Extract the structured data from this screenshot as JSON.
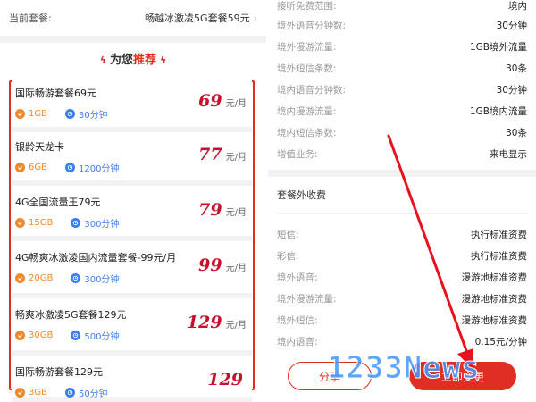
{
  "current_plan": {
    "label": "当前套餐:",
    "value": "畅越冰激凌5G套餐59元"
  },
  "recommend": {
    "title_prefix": "为您",
    "title_highlight": "推荐"
  },
  "cards": [
    {
      "name": "国际畅游套餐69元",
      "data": "1GB",
      "minutes": "30分钟",
      "price": "69",
      "unit": "元/月"
    },
    {
      "name": "银龄天龙卡",
      "data": "6GB",
      "minutes": "1200分钟",
      "price": "77",
      "unit": "元/月"
    },
    {
      "name": "4G全国流量王79元",
      "data": "15GB",
      "minutes": "300分钟",
      "price": "79",
      "unit": "元/月"
    },
    {
      "name": "4G畅爽冰激凌国内流量套餐-99元/月",
      "data": "20GB",
      "minutes": "300分钟",
      "price": "99",
      "unit": "元/月"
    },
    {
      "name": "畅爽冰激凌5G套餐129元",
      "data": "30GB",
      "minutes": "500分钟",
      "price": "129",
      "unit": "元/月"
    },
    {
      "name": "国际畅游套餐129元",
      "data": "3GB",
      "minutes": "50分钟",
      "price": "129",
      "unit": ""
    }
  ],
  "details": [
    {
      "label": "接听免费范围:",
      "value": "境内"
    },
    {
      "label": "境外语音分钟数:",
      "value": "30分钟"
    },
    {
      "label": "境外漫游流量:",
      "value": "1GB境外流量"
    },
    {
      "label": "境外短信条数:",
      "value": "30条"
    },
    {
      "label": "境内语音分钟数:",
      "value": "30分钟"
    },
    {
      "label": "境内漫游流量:",
      "value": "1GB境内流量"
    },
    {
      "label": "境内短信条数:",
      "value": "30条"
    },
    {
      "label": "增值业务:",
      "value": "来电显示"
    }
  ],
  "extra": {
    "title": "套餐外收费",
    "rows": [
      {
        "label": "短信:",
        "value": "执行标准资费"
      },
      {
        "label": "彩信:",
        "value": "执行标准资费"
      },
      {
        "label": "境外语音:",
        "value": "漫游地标准资费"
      },
      {
        "label": "境外漫游流量:",
        "value": "漫游地标准资费"
      },
      {
        "label": "境外短信:",
        "value": "漫游地标准资费"
      },
      {
        "label": "境内语音:",
        "value": "0.15元/分钟"
      }
    ]
  },
  "buttons": {
    "share": "分享",
    "change": "立即变更"
  },
  "watermark": "1233News",
  "colors": {
    "accent": "#e02e24",
    "price": "#c8102e",
    "data_tag": "#f0892b",
    "minutes_tag": "#3d7ff0"
  },
  "icons": {
    "data": "data-icon",
    "minutes": "phone-clock-icon",
    "bolt": "lightning-icon",
    "chevron": "chevron-right-icon"
  }
}
